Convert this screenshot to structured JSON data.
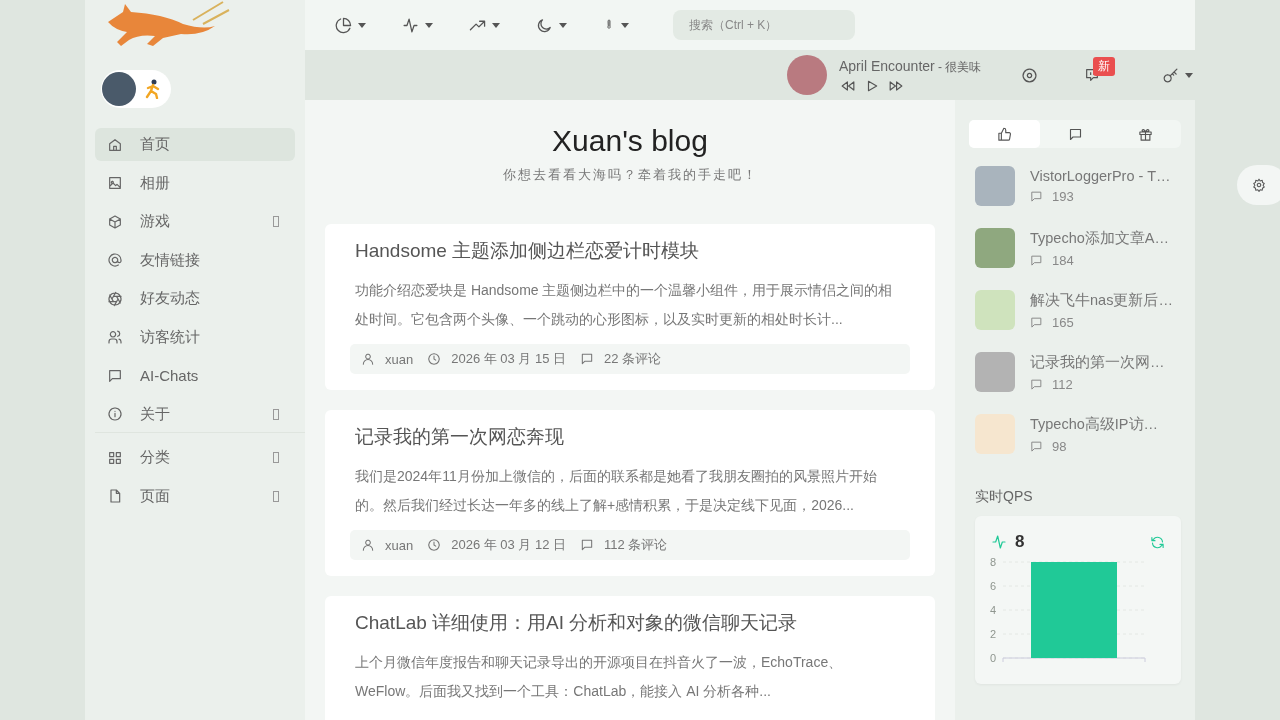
{
  "toolbar": {
    "menus": [
      {
        "kind": "pie"
      },
      {
        "kind": "activity"
      },
      {
        "kind": "trend"
      },
      {
        "kind": "moon"
      },
      {
        "kind": "thermo"
      }
    ],
    "search": {
      "placeholder": "搜索（Ctrl + K）"
    }
  },
  "player": {
    "title": "April Encounter",
    "artist": " - 很美味",
    "badge": "新"
  },
  "nav": {
    "groups": [
      [
        {
          "label": "首页",
          "kind": "home",
          "selected": true,
          "has_submenu": false
        },
        {
          "label": "相册",
          "kind": "image",
          "selected": false,
          "has_submenu": false
        },
        {
          "label": "游戏",
          "kind": "box",
          "selected": false,
          "has_submenu": true
        },
        {
          "label": "友情链接",
          "kind": "at",
          "selected": false,
          "has_submenu": false
        },
        {
          "label": "好友动态",
          "kind": "aperture",
          "selected": false,
          "has_submenu": false
        },
        {
          "label": "访客统计",
          "kind": "users",
          "selected": false,
          "has_submenu": false
        },
        {
          "label": "AI-Chats",
          "kind": "chat",
          "selected": false,
          "has_submenu": false
        },
        {
          "label": "关于",
          "kind": "info",
          "selected": false,
          "has_submenu": true
        }
      ],
      [
        {
          "label": "分类",
          "kind": "grid",
          "selected": false,
          "has_submenu": true
        },
        {
          "label": "页面",
          "kind": "file",
          "selected": false,
          "has_submenu": true
        }
      ]
    ]
  },
  "blog": {
    "title": "Xuan's blog",
    "subtitle": "你想去看看大海吗？牵着我的手走吧！"
  },
  "posts": [
    {
      "title": "Handsome 主题添加侧边栏恋爱计时模块",
      "excerpt": "功能介绍恋爱块是 Handsome 主题侧边栏中的一个温馨小组件，用于展示情侣之间的相处时间。它包含两个头像、一个跳动的心形图标，以及实时更新的相处时长计...",
      "author": "xuan",
      "date": "2026 年 03 月 15 日",
      "comments": "22 条评论"
    },
    {
      "title": "记录我的第一次网恋奔现",
      "excerpt": "我们是2024年11月份加上微信的，后面的联系都是她看了我朋友圈拍的风景照片开始的。然后我们经过长达一年多的线上了解+感情积累，于是决定线下见面，2026...",
      "author": "xuan",
      "date": "2026 年 03 月 12 日",
      "comments": "112 条评论"
    },
    {
      "title": "ChatLab 详细使用：用AI 分析和对象的微信聊天记录",
      "excerpt": "上个月微信年度报告和聊天记录导出的开源项目在抖音火了一波，EchoTrace、WeFlow。后面我又找到一个工具：ChatLab，能接入 AI 分析各种..."
    }
  ],
  "side_tabs": [
    {
      "kind": "thumb",
      "selected": true
    },
    {
      "kind": "chat",
      "selected": false
    },
    {
      "kind": "gift",
      "selected": false
    }
  ],
  "popular": [
    {
      "title": "VistorLoggerPro - T…",
      "count": "193",
      "color": "#a9b4bd"
    },
    {
      "title": "Typecho添加文章A…",
      "count": "184",
      "color": "#8fa87f"
    },
    {
      "title": "解决飞牛nas更新后…",
      "count": "165",
      "color": "#cfe3bd"
    },
    {
      "title": "记录我的第一次网…",
      "count": "112",
      "color": "#b3b3b3"
    },
    {
      "title": "Typecho高级IP访…",
      "count": "98",
      "color": "#f6e6cf"
    }
  ],
  "qps": {
    "heading": "实时QPS",
    "value": "8",
    "chart_data": {
      "type": "bar",
      "values": [
        8
      ],
      "ylim": [
        0,
        8
      ],
      "yticks": [
        0,
        2,
        4,
        6,
        8
      ],
      "grid": true
    }
  }
}
